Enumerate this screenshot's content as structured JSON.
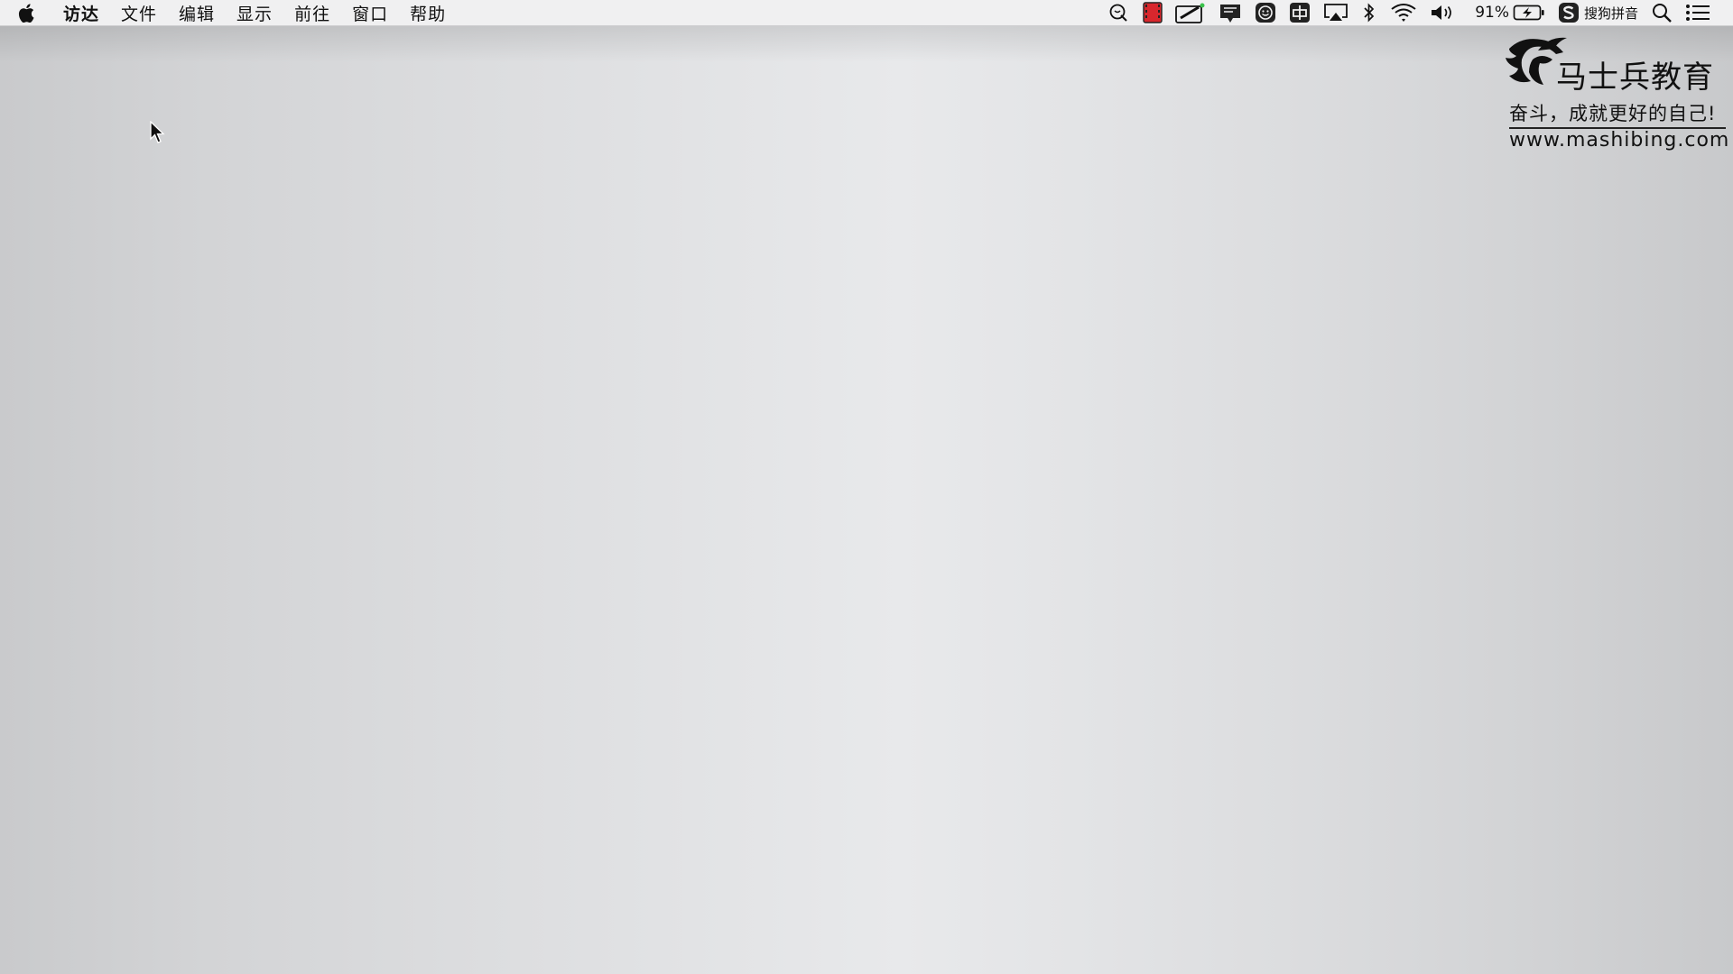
{
  "menubar": {
    "apple_icon": "apple-logo-icon",
    "items": [
      {
        "label": "访达"
      },
      {
        "label": "文件"
      },
      {
        "label": "编辑"
      },
      {
        "label": "显示"
      },
      {
        "label": "前往"
      },
      {
        "label": "窗口"
      },
      {
        "label": "帮助"
      }
    ],
    "status": {
      "tray_icons": [
        "qq-icon",
        "screen-recorder-icon",
        "drawing-tablet-icon",
        "notification-icon",
        "emoji-icon",
        "input-grid-icon",
        "airplay-icon",
        "bluetooth-icon",
        "wifi-icon",
        "volume-icon"
      ],
      "battery_percent": "91%",
      "battery_charging": true,
      "input_method": "搜狗拼音",
      "spotlight_icon": "search-icon",
      "notification_center_icon": "list-icon"
    }
  },
  "watermark": {
    "brand": "马士兵教育",
    "slogan": "奋斗，成就更好的自己!",
    "url": "www.mashibing.com"
  },
  "colors": {
    "menubar_bg": "#f0f0f1",
    "desktop_edge": "#c9cacc",
    "desktop_center": "#e8e9eb",
    "recorder_red": "#d8272d"
  }
}
